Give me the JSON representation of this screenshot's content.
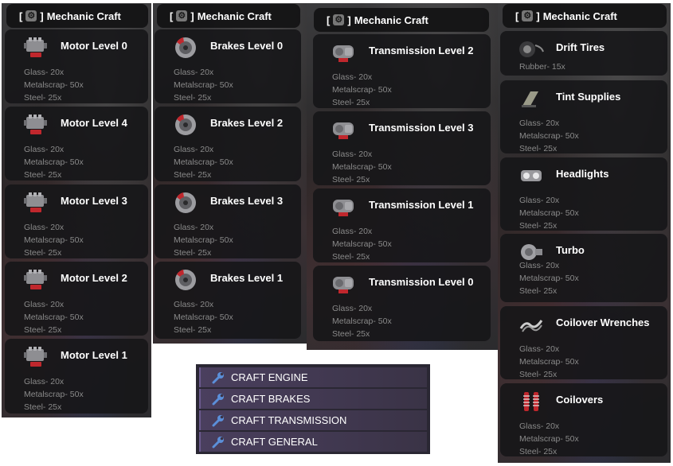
{
  "header_title": "Mechanic Craft",
  "header_bracket_open": "[",
  "header_bracket_close": "]",
  "columns": [
    {
      "items": [
        {
          "name": "Motor Level 0",
          "reqs": [
            "Glass- 20x",
            "Metalscrap- 50x",
            "Steel- 25x"
          ],
          "icon": "engine-icon"
        },
        {
          "name": "Motor Level 4",
          "reqs": [
            "Glass- 20x",
            "Metalscrap- 50x",
            "Steel- 25x"
          ],
          "icon": "engine-icon"
        },
        {
          "name": "Motor Level 3",
          "reqs": [
            "Glass- 20x",
            "Metalscrap- 50x",
            "Steel- 25x"
          ],
          "icon": "engine-icon"
        },
        {
          "name": "Motor Level 2",
          "reqs": [
            "Glass- 20x",
            "Metalscrap- 50x",
            "Steel- 25x"
          ],
          "icon": "engine-icon"
        },
        {
          "name": "Motor Level 1",
          "reqs": [
            "Glass- 20x",
            "Metalscrap- 50x",
            "Steel- 25x"
          ],
          "icon": "engine-icon"
        }
      ]
    },
    {
      "items": [
        {
          "name": "Brakes Level 0",
          "reqs": [
            "Glass- 20x",
            "Metalscrap- 50x",
            "Steel- 25x"
          ],
          "icon": "brake-disc-icon"
        },
        {
          "name": "Brakes Level 2",
          "reqs": [
            "Glass- 20x",
            "Metalscrap- 50x",
            "Steel- 25x"
          ],
          "icon": "brake-disc-icon"
        },
        {
          "name": "Brakes Level 3",
          "reqs": [
            "Glass- 20x",
            "Metalscrap- 50x",
            "Steel- 25x"
          ],
          "icon": "brake-disc-icon"
        },
        {
          "name": "Brakes Level 1",
          "reqs": [
            "Glass- 20x",
            "Metalscrap- 50x",
            "Steel- 25x"
          ],
          "icon": "brake-disc-icon"
        }
      ]
    },
    {
      "items": [
        {
          "name": "Transmission Level 2",
          "reqs": [
            "Glass- 20x",
            "Metalscrap- 50x",
            "Steel- 25x"
          ],
          "icon": "transmission-icon"
        },
        {
          "name": "Transmission Level 3",
          "reqs": [
            "Glass- 20x",
            "Metalscrap- 50x",
            "Steel- 25x"
          ],
          "icon": "transmission-icon"
        },
        {
          "name": "Transmission Level 1",
          "reqs": [
            "Glass- 20x",
            "Metalscrap- 50x",
            "Steel- 25x"
          ],
          "icon": "transmission-icon"
        },
        {
          "name": "Transmission Level 0",
          "reqs": [
            "Glass- 20x",
            "Metalscrap- 50x",
            "Steel- 25x"
          ],
          "icon": "transmission-icon"
        }
      ]
    },
    {
      "items": [
        {
          "name": "Drift Tires",
          "reqs": [
            "Rubber- 15x"
          ],
          "icon": "tire-icon"
        },
        {
          "name": "Tint Supplies",
          "reqs": [
            "Glass- 20x",
            "Metalscrap- 50x",
            "Steel- 25x"
          ],
          "icon": "tint-icon"
        },
        {
          "name": "Headlights",
          "reqs": [
            "Glass- 20x",
            "Metalscrap- 50x",
            "Steel- 25x"
          ],
          "icon": "headlights-icon"
        },
        {
          "name": "Turbo",
          "reqs": [
            "Glass- 20x",
            "Metalscrap- 50x",
            "Steel- 25x"
          ],
          "icon": "turbo-icon"
        },
        {
          "name": "Coilover Wrenches",
          "reqs": [
            "Glass- 20x",
            "Metalscrap- 50x",
            "Steel- 25x"
          ],
          "icon": "wrench-icon"
        },
        {
          "name": "Coilovers",
          "reqs": [
            "Glass- 20x",
            "Metalscrap- 50x",
            "Steel- 25x"
          ],
          "icon": "coilover-icon"
        }
      ]
    }
  ],
  "menu": [
    {
      "label": "CRAFT ENGINE",
      "icon": "wrench-icon"
    },
    {
      "label": "CRAFT BRAKES",
      "icon": "wrench-icon"
    },
    {
      "label": "CRAFT TRANSMISSION",
      "icon": "wrench-icon"
    },
    {
      "label": "CRAFT GENERAL",
      "icon": "wrench-icon"
    }
  ],
  "colors": {
    "accent_red": "#c0272d",
    "menu_bg": "#2a2733",
    "menu_item": "#4a3f5e"
  }
}
